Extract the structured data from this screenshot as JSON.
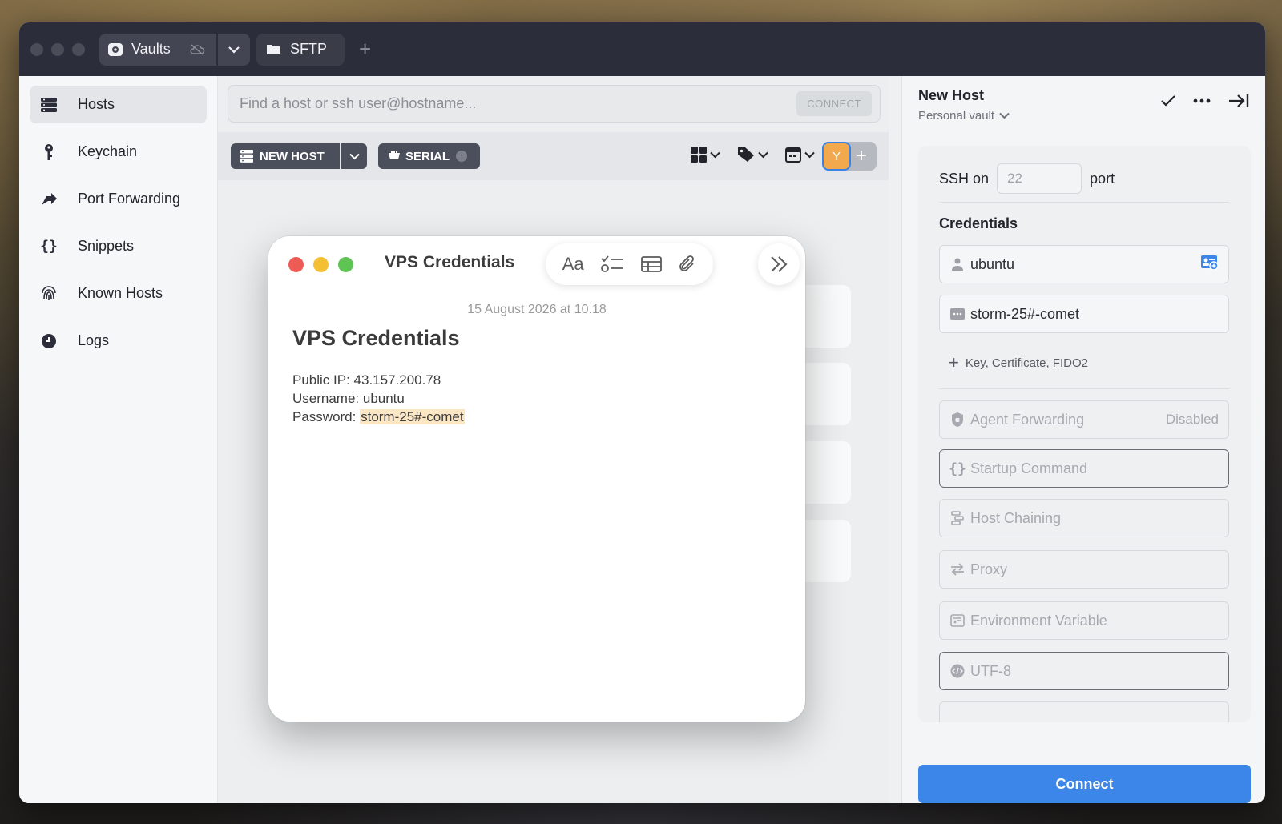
{
  "titlebar": {
    "vaults_tab": "Vaults",
    "sftp_tab": "SFTP",
    "add_tab": "+"
  },
  "sidebar": {
    "items": [
      {
        "label": "Hosts",
        "icon": "hosts-icon"
      },
      {
        "label": "Keychain",
        "icon": "key-icon"
      },
      {
        "label": "Port Forwarding",
        "icon": "port-forwarding-icon"
      },
      {
        "label": "Snippets",
        "icon": "snippets-icon"
      },
      {
        "label": "Known Hosts",
        "icon": "fingerprint-icon"
      },
      {
        "label": "Logs",
        "icon": "clock-icon"
      }
    ]
  },
  "search": {
    "placeholder": "Find a host or ssh user@hostname...",
    "connect_label": "CONNECT"
  },
  "toolbar": {
    "new_host_label": "NEW HOST",
    "serial_label": "SERIAL",
    "avatar_initial": "Y"
  },
  "note": {
    "window_title": "VPS Credentials",
    "date": "15 August 2026 at 10.18",
    "heading": "VPS Credentials",
    "lines": {
      "ip": "Public IP: 43.157.200.78",
      "username": "Username: ubuntu",
      "password_prefix": "Password: ",
      "password_value": "storm-25#-comet"
    },
    "tools": {
      "format": "Aa"
    }
  },
  "panel": {
    "title": "New Host",
    "vault": "Personal vault",
    "ssh_label": "SSH on",
    "port_placeholder": "22",
    "port_label": "port",
    "credentials_label": "Credentials",
    "username_value": "ubuntu",
    "password_value": "storm-25#-comet",
    "add_key_label": "Key, Certificate, FIDO2",
    "agent_forwarding_label": "Agent Forwarding",
    "agent_forwarding_value": "Disabled",
    "startup_command": "Startup Command",
    "host_chaining": "Host Chaining",
    "proxy": "Proxy",
    "environment_variable": "Environment Variable",
    "charset": "UTF-8",
    "connect_label": "Connect"
  },
  "colors": {
    "accent": "#3b86e8",
    "titlebar": "#2b2d3a",
    "avatar": "#f2a94e",
    "highlight": "#fbe7c4"
  }
}
